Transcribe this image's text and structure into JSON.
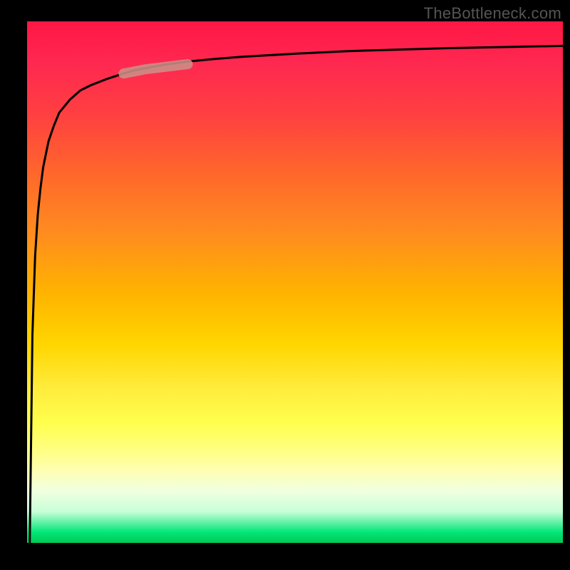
{
  "watermark": "TheBottleneck.com",
  "colors": {
    "background": "#000000",
    "gradient_top": "#ff1744",
    "gradient_mid": "#ffeb3b",
    "gradient_bottom": "#00c853",
    "curve": "#000000",
    "highlight": "#cc8f88"
  },
  "chart_data": {
    "type": "line",
    "title": "",
    "xlabel": "",
    "ylabel": "",
    "xlim": [
      0,
      100
    ],
    "ylim": [
      0,
      100
    ],
    "annotations": [
      "TheBottleneck.com"
    ],
    "series": [
      {
        "name": "bottleneck-curve",
        "x": [
          0.5,
          1,
          1.5,
          2,
          2.5,
          3,
          4,
          5,
          6,
          8,
          10,
          12,
          15,
          18,
          20,
          25,
          30,
          35,
          40,
          50,
          60,
          70,
          80,
          90,
          100
        ],
        "values": [
          0,
          40,
          55,
          63,
          68,
          72,
          77,
          80,
          82.5,
          85,
          86.8,
          87.8,
          89,
          90,
          90.6,
          91.6,
          92.3,
          92.8,
          93.2,
          93.8,
          94.3,
          94.6,
          94.9,
          95.1,
          95.3
        ]
      },
      {
        "name": "highlighted-segment",
        "x": [
          18,
          22,
          26,
          30
        ],
        "values": [
          90,
          90.8,
          91.3,
          91.8
        ]
      }
    ]
  }
}
